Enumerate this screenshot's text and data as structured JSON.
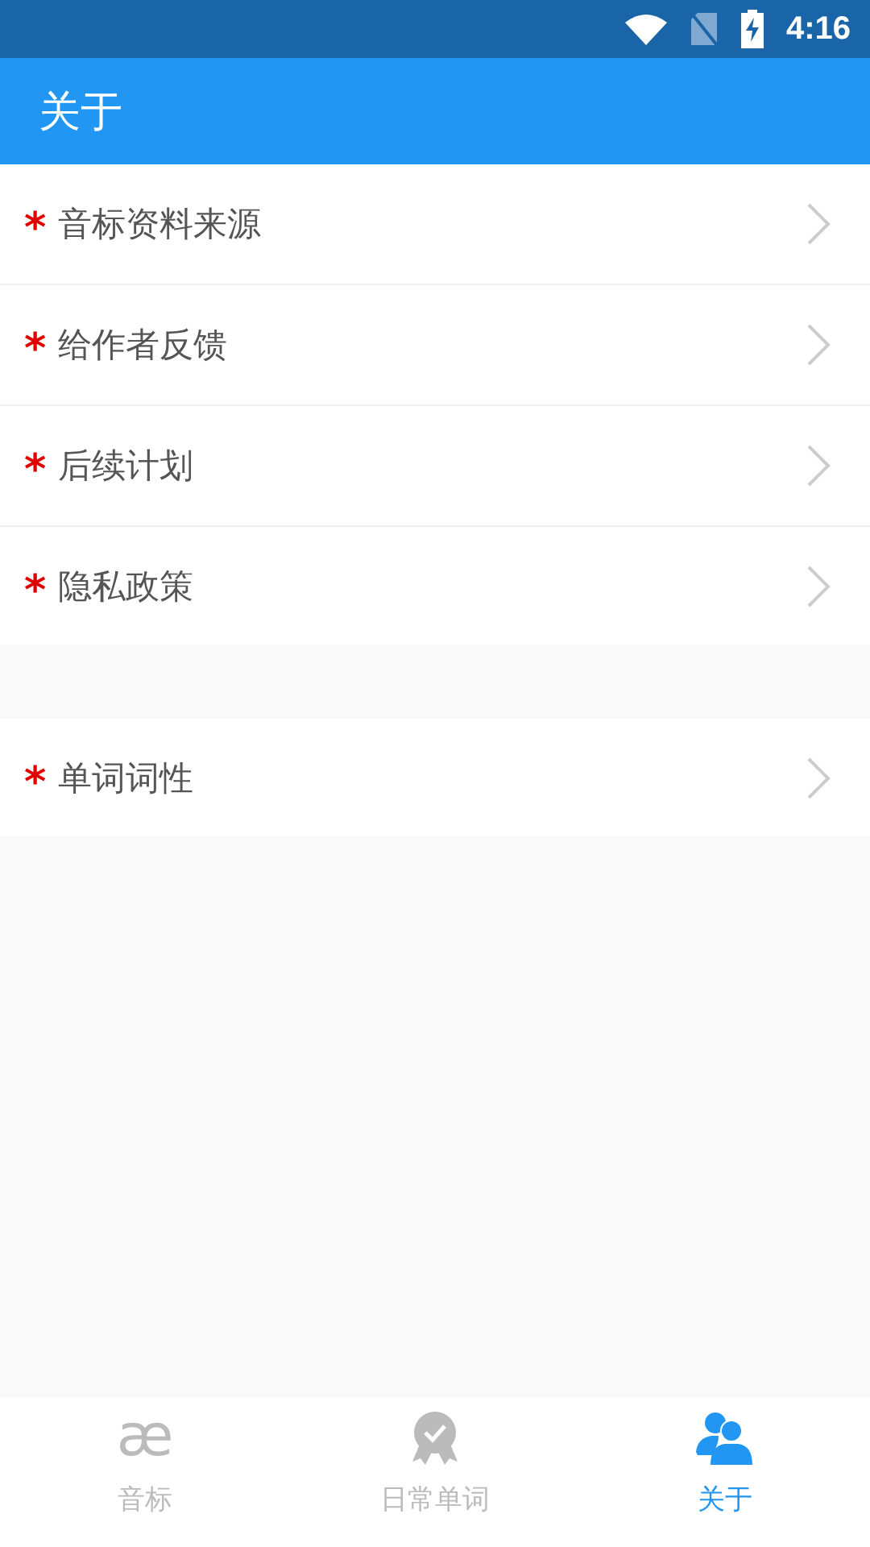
{
  "status_bar": {
    "time": "4:16"
  },
  "header": {
    "title": "关于"
  },
  "sections": [
    {
      "items": [
        {
          "marker": "*",
          "label": "音标资料来源"
        },
        {
          "marker": "*",
          "label": "给作者反馈"
        },
        {
          "marker": "*",
          "label": "后续计划"
        },
        {
          "marker": "*",
          "label": "隐私政策"
        }
      ]
    },
    {
      "items": [
        {
          "marker": "*",
          "label": "单词词性"
        }
      ]
    }
  ],
  "tabs": [
    {
      "kind": "glyph",
      "glyph": "æ",
      "label": "音标",
      "selected": false
    },
    {
      "kind": "badge",
      "label": "日常单词",
      "selected": false
    },
    {
      "kind": "users",
      "label": "关于",
      "selected": true
    }
  ]
}
